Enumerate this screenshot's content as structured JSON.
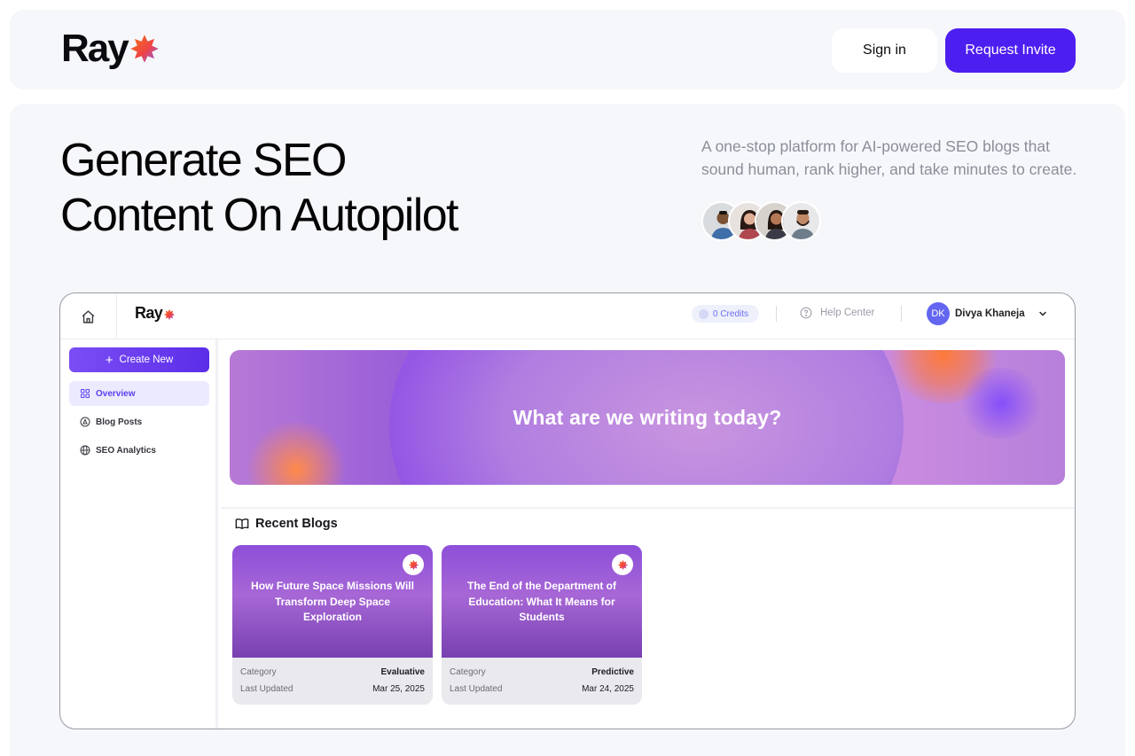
{
  "brand": {
    "name": "Ray"
  },
  "nav": {
    "signin_label": "Sign in",
    "invite_label": "Request Invite"
  },
  "hero": {
    "headline_line1": "Generate SEO",
    "headline_line2": "Content On Autopilot",
    "subtext": "A one-stop platform for AI-powered SEO blogs that sound human, rank higher, and take minutes to create."
  },
  "app": {
    "logo": "Ray",
    "credits": "0 Credits",
    "help_center": "Help Center",
    "user": {
      "initials": "DK",
      "name": "Divya Khaneja"
    },
    "create_new": "Create New",
    "sidebar": [
      {
        "label": "Overview",
        "icon": "grid-icon",
        "active": true
      },
      {
        "label": "Blog Posts",
        "icon": "pen-circle-icon"
      },
      {
        "label": "SEO Analytics",
        "icon": "globe-icon"
      }
    ],
    "banner_text": "What are we writing today?",
    "recent_title": "Recent Blogs",
    "blogs": [
      {
        "title": "How Future Space Missions Will Transform Deep Space Exploration",
        "category_label": "Category",
        "category": "Evaluative",
        "updated_label": "Last Updated",
        "updated": "Mar 25, 2025"
      },
      {
        "title": "The End of the Department of Education: What It Means for Students",
        "category_label": "Category",
        "category": "Predictive",
        "updated_label": "Last Updated",
        "updated": "Mar 24, 2025"
      }
    ]
  },
  "colors": {
    "accent": "#4d1ef0",
    "star_orange": "#f97316",
    "star_purple": "#8b5cf6",
    "avatar": "#6366f1",
    "page_bg": "#f6f7fb"
  }
}
